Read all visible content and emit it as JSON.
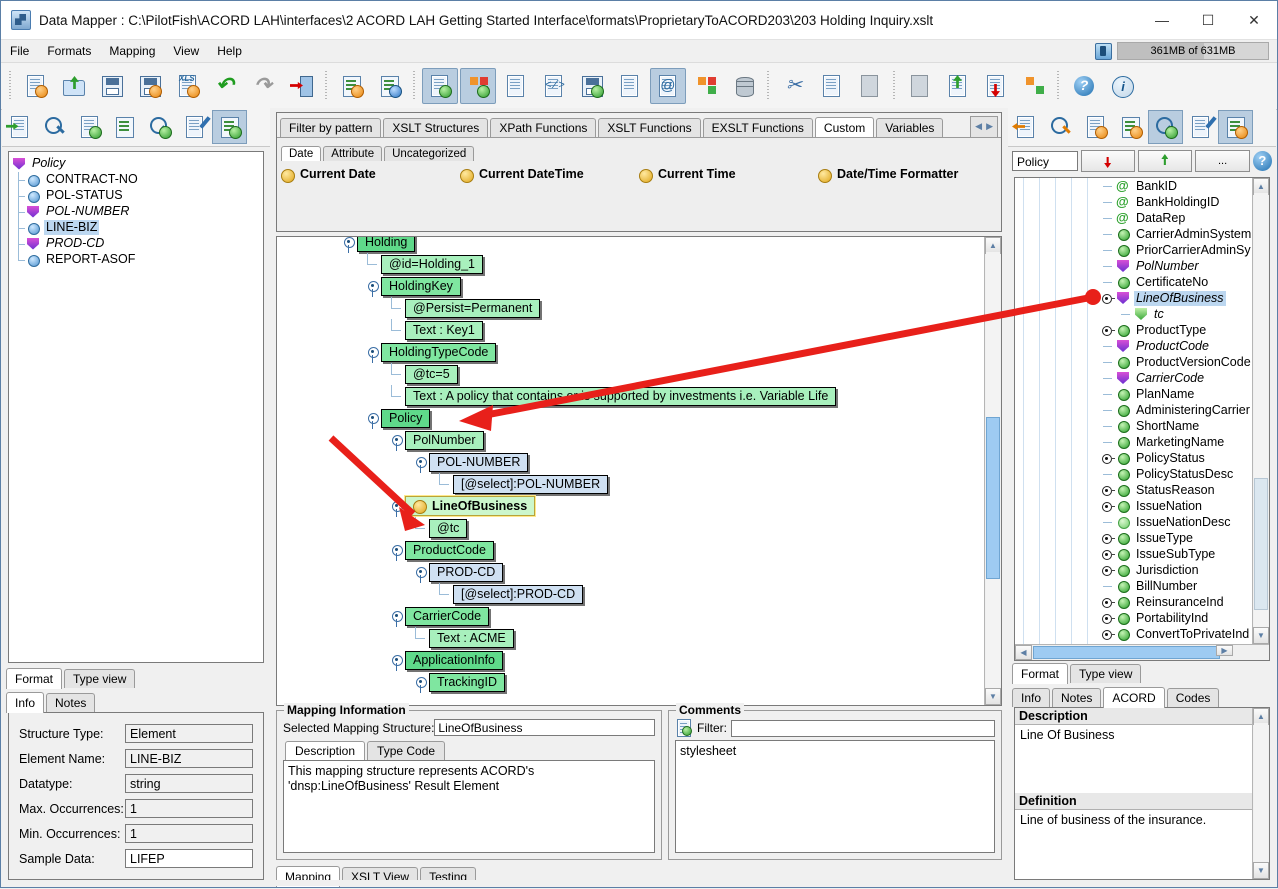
{
  "window": {
    "title": "Data Mapper : C:\\PilotFish\\ACORD LAH\\interfaces\\2 ACORD LAH Getting Started Interface\\formats\\ProprietaryToACORD203\\203 Holding Inquiry.xslt",
    "minimize": "—",
    "maximize": "☐",
    "close": "✕",
    "app_icon": "data-mapper-icon"
  },
  "menu": {
    "items": [
      "File",
      "Formats",
      "Mapping",
      "View",
      "Help"
    ],
    "memory": "361MB of 631MB",
    "memory_used_pct": 57
  },
  "toolbar": {
    "groups": [
      {
        "buttons": [
          {
            "name": "new-file",
            "icon": "new-document-icon",
            "selected": false
          },
          {
            "name": "open-file",
            "icon": "open-folder-icon",
            "selected": false
          },
          {
            "name": "save",
            "icon": "save-disk-icon",
            "selected": false
          },
          {
            "name": "save-as",
            "icon": "save-as-disk-icon",
            "selected": false
          },
          {
            "name": "export-xls",
            "icon": "export-xls-icon",
            "selected": false
          },
          {
            "name": "undo",
            "icon": "undo-arrow-icon",
            "selected": false
          },
          {
            "name": "redo",
            "icon": "redo-arrow-icon",
            "selected": false
          },
          {
            "name": "exit",
            "icon": "exit-door-icon",
            "selected": false
          }
        ]
      },
      {
        "buttons": [
          {
            "name": "add-format",
            "icon": "add-format-icon",
            "selected": false
          },
          {
            "name": "format-settings",
            "icon": "format-settings-icon",
            "selected": false
          }
        ]
      },
      {
        "buttons": [
          {
            "name": "show-info",
            "icon": "document-info-icon",
            "selected": true
          },
          {
            "name": "show-colors",
            "icon": "color-blocks-icon",
            "selected": true
          },
          {
            "name": "validate",
            "icon": "validate-checklist-icon",
            "selected": false
          },
          {
            "name": "source-view",
            "icon": "code-document-icon",
            "selected": false
          },
          {
            "name": "save-snapshot",
            "icon": "save-clock-icon",
            "selected": false
          },
          {
            "name": "lock-document",
            "icon": "lock-document-icon",
            "selected": false
          },
          {
            "name": "attribute-view",
            "icon": "at-document-icon",
            "selected": true
          },
          {
            "name": "table-view",
            "icon": "table-edit-icon",
            "selected": false
          },
          {
            "name": "database",
            "icon": "database-icon",
            "selected": false
          }
        ]
      },
      {
        "buttons": [
          {
            "name": "cut",
            "icon": "scissors-icon",
            "selected": false
          },
          {
            "name": "copy",
            "icon": "copy-pages-icon",
            "selected": false
          },
          {
            "name": "paste",
            "icon": "paste-page-icon",
            "selected": false
          }
        ]
      },
      {
        "buttons": [
          {
            "name": "merge-nodes",
            "icon": "merge-shapes-icon",
            "selected": false
          },
          {
            "name": "move-up",
            "icon": "move-up-icon",
            "selected": false
          },
          {
            "name": "move-down",
            "icon": "move-down-icon",
            "selected": false
          },
          {
            "name": "group-rows",
            "icon": "group-rows-icon",
            "selected": false
          }
        ]
      },
      {
        "buttons": [
          {
            "name": "help",
            "icon": "help-question-icon",
            "selected": false
          },
          {
            "name": "about",
            "icon": "about-info-icon",
            "selected": false
          }
        ]
      }
    ]
  },
  "left_panel": {
    "toolbar": [
      {
        "name": "load-source-format",
        "icon": "import-document-icon",
        "selected": false
      },
      {
        "name": "find-source",
        "icon": "search-right-icon",
        "selected": false
      },
      {
        "name": "notes",
        "icon": "notepad-icon",
        "selected": false
      },
      {
        "name": "attributes-list",
        "icon": "list-lines-icon",
        "selected": false
      },
      {
        "name": "preview-source",
        "icon": "magnifier-eye-icon",
        "selected": false
      },
      {
        "name": "edit-source",
        "icon": "edit-pencil-icon",
        "selected": false
      },
      {
        "name": "tree-view-source",
        "icon": "tree-search-icon",
        "selected": true
      }
    ],
    "tree": [
      {
        "label": "Policy",
        "icon": "shield-icon",
        "italic": true,
        "selected": false,
        "depth": 0
      },
      {
        "label": "CONTRACT-NO",
        "icon": "blue-ball-icon",
        "italic": false,
        "selected": false,
        "depth": 1
      },
      {
        "label": "POL-STATUS",
        "icon": "blue-ball-icon",
        "italic": false,
        "selected": false,
        "depth": 1
      },
      {
        "label": "POL-NUMBER",
        "icon": "shield-icon",
        "italic": true,
        "selected": false,
        "depth": 1
      },
      {
        "label": "LINE-BIZ",
        "icon": "blue-ball-icon",
        "italic": false,
        "selected": true,
        "depth": 1
      },
      {
        "label": "PROD-CD",
        "icon": "shield-icon",
        "italic": true,
        "selected": false,
        "depth": 1
      },
      {
        "label": "REPORT-ASOF",
        "icon": "blue-ball-icon",
        "italic": false,
        "selected": false,
        "depth": 1
      }
    ],
    "view_tabs": [
      {
        "label": "Format",
        "active": true
      },
      {
        "label": "Type view",
        "active": false
      }
    ],
    "info_tabs": [
      {
        "label": "Info",
        "active": true
      },
      {
        "label": "Notes",
        "active": false
      }
    ],
    "info_fields": [
      {
        "label": "Structure Type:",
        "value": "Element",
        "editable": false
      },
      {
        "label": "Element Name:",
        "value": "LINE-BIZ",
        "editable": false
      },
      {
        "label": "Datatype:",
        "value": "string",
        "editable": false
      },
      {
        "label": "Max. Occurrences:",
        "value": "1",
        "editable": false
      },
      {
        "label": "Min. Occurrences:",
        "value": "1",
        "editable": false
      },
      {
        "label": "Sample Data:",
        "value": "LIFEP",
        "editable": true
      }
    ]
  },
  "center_panel": {
    "function_tabs": [
      {
        "label": "Filter by pattern",
        "active": false
      },
      {
        "label": "XSLT Structures",
        "active": false
      },
      {
        "label": "XPath Functions",
        "active": false
      },
      {
        "label": "XSLT Functions",
        "active": false
      },
      {
        "label": "EXSLT Functions",
        "active": false
      },
      {
        "label": "Custom",
        "active": true
      },
      {
        "label": "Variables",
        "active": false
      }
    ],
    "tab_scroll_left": "◀",
    "tab_scroll_right": "▶",
    "sub_tabs": [
      {
        "label": "Date",
        "active": true
      },
      {
        "label": "Attribute",
        "active": false
      },
      {
        "label": "Uncategorized",
        "active": false
      }
    ],
    "functions": [
      {
        "label": "Current Date",
        "icon": "yellow-bulb-icon"
      },
      {
        "label": "Current DateTime",
        "icon": "yellow-bulb-icon"
      },
      {
        "label": "Current Time",
        "icon": "yellow-bulb-icon"
      },
      {
        "label": "Date/Time Formatter",
        "icon": "yellow-bulb-icon"
      }
    ],
    "mapping_tree": [
      {
        "label": "Holding",
        "style": "dark",
        "indent": 0,
        "handle": true,
        "clipped": true
      },
      {
        "label": "@id=Holding_1",
        "style": "light",
        "indent": 1,
        "handle": false
      },
      {
        "label": "HoldingKey",
        "style": "mid",
        "indent": 1,
        "handle": true
      },
      {
        "label": "@Persist=Permanent",
        "style": "light",
        "indent": 2,
        "handle": false
      },
      {
        "label": "Text : Key1",
        "style": "light",
        "indent": 2,
        "handle": false
      },
      {
        "label": "HoldingTypeCode",
        "style": "mid",
        "indent": 1,
        "handle": true
      },
      {
        "label": "@tc=5",
        "style": "light",
        "indent": 2,
        "handle": false
      },
      {
        "label": "Text : A policy that contains or is supported by investments i.e. Variable Life",
        "style": "light",
        "indent": 2,
        "handle": false
      },
      {
        "label": "Policy",
        "style": "dark",
        "indent": 1,
        "handle": true
      },
      {
        "label": "PolNumber",
        "style": "light",
        "indent": 2,
        "handle": true
      },
      {
        "label": "POL-NUMBER",
        "style": "blue",
        "indent": 3,
        "handle": true
      },
      {
        "label": "[@select]:POL-NUMBER",
        "style": "blue",
        "indent": 4,
        "handle": false
      },
      {
        "label": "LineOfBusiness",
        "style": "selected",
        "indent": 2,
        "handle": true,
        "icon": "yellow-bulb-icon"
      },
      {
        "label": "@tc",
        "style": "light",
        "indent": 3,
        "handle": false
      },
      {
        "label": "ProductCode",
        "style": "mid",
        "indent": 2,
        "handle": true
      },
      {
        "label": "PROD-CD",
        "style": "blue",
        "indent": 3,
        "handle": true
      },
      {
        "label": "[@select]:PROD-CD",
        "style": "blue",
        "indent": 4,
        "handle": false
      },
      {
        "label": "CarrierCode",
        "style": "mid",
        "indent": 2,
        "handle": true
      },
      {
        "label": "Text : ACME",
        "style": "light",
        "indent": 3,
        "handle": false
      },
      {
        "label": "ApplicationInfo",
        "style": "dark",
        "indent": 2,
        "handle": true
      },
      {
        "label": "TrackingID",
        "style": "mid",
        "indent": 3,
        "handle": true
      }
    ],
    "mapping_info": {
      "group_title": "Mapping Information",
      "selected_label": "Selected Mapping Structure:",
      "selected_value": "LineOfBusiness",
      "tabs": [
        {
          "label": "Description",
          "active": true
        },
        {
          "label": "Type Code",
          "active": false
        }
      ],
      "description": "This mapping structure represents ACORD's 'dnsp:LineOfBusiness' Result Element"
    },
    "comments": {
      "group_title": "Comments",
      "filter_label": "Filter:",
      "filter_value": "",
      "filter_icon": "notepad-icon",
      "items": [
        "stylesheet"
      ]
    },
    "bottom_tabs": [
      {
        "label": "Mapping",
        "active": true
      },
      {
        "label": "XSLT View",
        "active": false
      },
      {
        "label": "Testing",
        "active": false
      }
    ]
  },
  "right_panel": {
    "toolbar": [
      {
        "name": "load-target-format",
        "icon": "export-document-icon",
        "selected": false
      },
      {
        "name": "find-target",
        "icon": "search-left-icon",
        "selected": false
      },
      {
        "name": "target-notes",
        "icon": "notepad-orange-icon",
        "selected": false
      },
      {
        "name": "target-attributes",
        "icon": "list-lines-orange-icon",
        "selected": false
      },
      {
        "name": "preview-target",
        "icon": "magnifier-eye-icon",
        "selected": true
      },
      {
        "name": "edit-target",
        "icon": "edit-pencil-icon",
        "selected": false
      },
      {
        "name": "tree-view-target",
        "icon": "tree-search-orange-icon",
        "selected": true
      }
    ],
    "combo_value": "Policy",
    "buttons": [
      {
        "name": "collapse-to-node",
        "label": "",
        "icon": "down-pin-icon"
      },
      {
        "name": "expand-from-node",
        "label": "",
        "icon": "up-pin-icon"
      },
      {
        "name": "more-options",
        "label": "..."
      }
    ],
    "help_icon": "help-question-icon",
    "tree": [
      {
        "label": "BankID",
        "icon": "at-icon",
        "italic": false,
        "selected": false,
        "handle": false
      },
      {
        "label": "BankHoldingID",
        "icon": "at-icon",
        "italic": false,
        "selected": false,
        "handle": false
      },
      {
        "label": "DataRep",
        "icon": "at-icon",
        "italic": false,
        "selected": false,
        "handle": false
      },
      {
        "label": "CarrierAdminSystem",
        "icon": "green-ball-icon",
        "italic": false,
        "selected": false,
        "handle": false
      },
      {
        "label": "PriorCarrierAdminSy",
        "icon": "green-ball-icon",
        "italic": false,
        "selected": false,
        "handle": false
      },
      {
        "label": "PolNumber",
        "icon": "shield-icon",
        "italic": true,
        "selected": false,
        "handle": false
      },
      {
        "label": "CertificateNo",
        "icon": "green-ball-icon",
        "italic": false,
        "selected": false,
        "handle": false
      },
      {
        "label": "LineOfBusiness",
        "icon": "shield-icon",
        "italic": true,
        "selected": true,
        "handle": true
      },
      {
        "label": "tc",
        "icon": "v-green-icon",
        "italic": true,
        "selected": false,
        "handle": false,
        "child": true
      },
      {
        "label": "ProductType",
        "icon": "green-ball-icon",
        "italic": false,
        "selected": false,
        "handle": true
      },
      {
        "label": "ProductCode",
        "icon": "shield-icon",
        "italic": true,
        "selected": false,
        "handle": false
      },
      {
        "label": "ProductVersionCode",
        "icon": "green-ball-icon",
        "italic": false,
        "selected": false,
        "handle": false
      },
      {
        "label": "CarrierCode",
        "icon": "shield-icon",
        "italic": true,
        "selected": false,
        "handle": false
      },
      {
        "label": "PlanName",
        "icon": "green-ball-icon",
        "italic": false,
        "selected": false,
        "handle": false
      },
      {
        "label": "AdministeringCarrier",
        "icon": "green-ball-icon",
        "italic": false,
        "selected": false,
        "handle": false
      },
      {
        "label": "ShortName",
        "icon": "green-ball-icon",
        "italic": false,
        "selected": false,
        "handle": false
      },
      {
        "label": "MarketingName",
        "icon": "green-ball-icon",
        "italic": false,
        "selected": false,
        "handle": false
      },
      {
        "label": "PolicyStatus",
        "icon": "green-ball-icon",
        "italic": false,
        "selected": false,
        "handle": true
      },
      {
        "label": "PolicyStatusDesc",
        "icon": "green-ball-icon",
        "italic": false,
        "selected": false,
        "handle": false
      },
      {
        "label": "StatusReason",
        "icon": "green-ball-icon",
        "italic": false,
        "selected": false,
        "handle": true
      },
      {
        "label": "IssueNation",
        "icon": "green-ball-icon",
        "italic": false,
        "selected": false,
        "handle": true
      },
      {
        "label": "IssueNationDesc",
        "icon": "light-green-ball-icon",
        "italic": false,
        "selected": false,
        "handle": false
      },
      {
        "label": "IssueType",
        "icon": "green-ball-icon",
        "italic": false,
        "selected": false,
        "handle": true
      },
      {
        "label": "IssueSubType",
        "icon": "green-ball-icon",
        "italic": false,
        "selected": false,
        "handle": true
      },
      {
        "label": "Jurisdiction",
        "icon": "green-ball-icon",
        "italic": false,
        "selected": false,
        "handle": true
      },
      {
        "label": "BillNumber",
        "icon": "green-ball-icon",
        "italic": false,
        "selected": false,
        "handle": false
      },
      {
        "label": "ReinsuranceInd",
        "icon": "green-ball-icon",
        "italic": false,
        "selected": false,
        "handle": true
      },
      {
        "label": "PortabilityInd",
        "icon": "green-ball-icon",
        "italic": false,
        "selected": false,
        "handle": true
      },
      {
        "label": "ConvertToPrivateInd",
        "icon": "green-ball-icon",
        "italic": false,
        "selected": false,
        "handle": true
      }
    ],
    "view_tabs": [
      {
        "label": "Format",
        "active": true
      },
      {
        "label": "Type view",
        "active": false
      }
    ],
    "info_tabs": [
      {
        "label": "Info",
        "active": false
      },
      {
        "label": "Notes",
        "active": false
      },
      {
        "label": "ACORD",
        "active": true
      },
      {
        "label": "Codes",
        "active": false
      }
    ],
    "acord": {
      "description_header": "Description",
      "description_value": "Line Of Business",
      "definition_header": "Definition",
      "definition_value": "Line of business of the insurance."
    }
  },
  "annotations": {
    "arrow_color": "#e8201a",
    "arrows": [
      {
        "name": "arrow-to-policy-node",
        "from": "right-tree-lineofbusiness",
        "to": "center-policy-node"
      },
      {
        "name": "arrow-to-lineofbusiness-node",
        "from": "left-upper",
        "to": "center-lineofbusiness-node"
      }
    ]
  }
}
